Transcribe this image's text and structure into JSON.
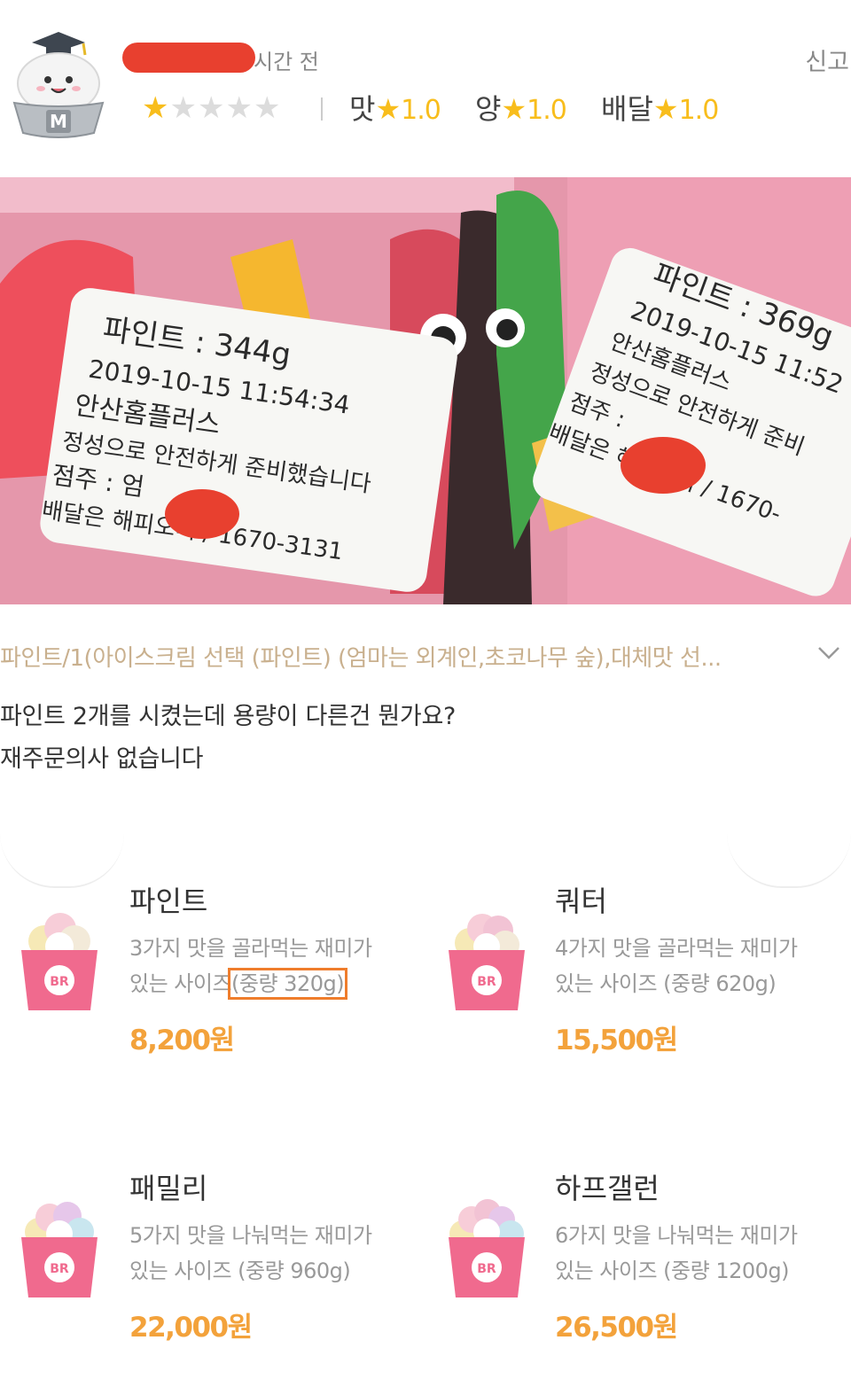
{
  "header": {
    "time_text": "시간 전",
    "report_label": "신고",
    "overall_stars": 1,
    "star_glyph": "★",
    "ratings": [
      {
        "label": "맛",
        "value": "1.0"
      },
      {
        "label": "양",
        "value": "1.0"
      },
      {
        "label": "배달",
        "value": "1.0"
      }
    ]
  },
  "photo": {
    "left_label": {
      "line1": "파인트 : 344g",
      "line2": "2019-10-15 11:54:34",
      "line3": "안산홈플러스",
      "line4": "정성으로 안전하게 준비했습니다",
      "line5": "점주 : 엄",
      "line6": "배달은 해피오더 / 1670-3131"
    },
    "right_label": {
      "line1": "파인트 : 369g",
      "line2": "2019-10-15 11:52",
      "line3": "안산홈플러스",
      "line4": "정성으로 안전하게 준비",
      "line5": "점주 :",
      "line6": "배달은 해피오더 / 1670-"
    }
  },
  "order": {
    "menu_text": "파인트/1(아이스크림 선택 (파인트) (엄마는 외계인,초코나무 숲),대체맛 선..."
  },
  "review": {
    "line1": "파인트 2개를 시켰는데 용량이 다른건 뭔가요?",
    "line2": "재주문의사 없습니다"
  },
  "products": [
    {
      "name": "파인트",
      "desc1": "3가지 맛을 골라먹는 재미가",
      "desc2a": "있는 사이즈",
      "desc2b": "(중량 320g)",
      "price": "8,200원"
    },
    {
      "name": "쿼터",
      "desc1": "4가지 맛을 골라먹는 재미가",
      "desc2a": "있는 사이즈",
      "desc2b": "(중량 620g)",
      "price": "15,500원"
    },
    {
      "name": "패밀리",
      "desc1": "5가지 맛을 나눠먹는 재미가",
      "desc2a": "있는 사이즈",
      "desc2b": "(중량 960g)",
      "price": "22,000원"
    },
    {
      "name": "하프갤런",
      "desc1": "6가지 맛을 나눠먹는 재미가",
      "desc2a": "있는 사이즈",
      "desc2b": "(중량 1200g)",
      "price": "26,500원"
    }
  ],
  "cup_logo": {
    "brand": "BR"
  },
  "colors": {
    "accent_price": "#f3a23b",
    "star": "#f8bd1c",
    "highlight_box": "#ef7d2c",
    "redaction": "#e8402f"
  }
}
